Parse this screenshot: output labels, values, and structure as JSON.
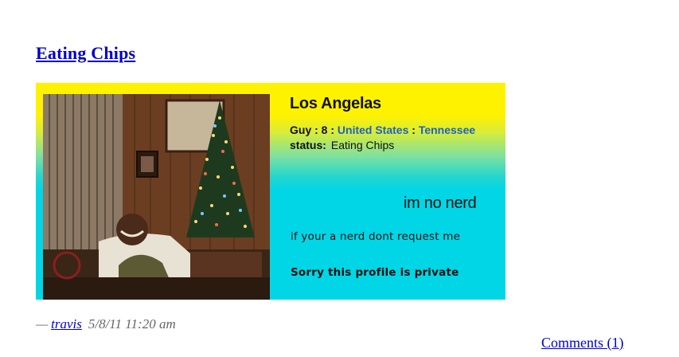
{
  "post": {
    "title": "Eating Chips",
    "meta": {
      "dash": "—",
      "author": "travis",
      "date": "5/8/11 11:20 am"
    },
    "comments_label": "Comments (1)"
  },
  "profile_card": {
    "name": "Los Angelas",
    "details_prefix": "Guy : 8 : ",
    "country": "United States",
    "separator": " : ",
    "state": "Tennessee",
    "status_label": "status:",
    "status_value": "Eating Chips",
    "headline": "im no nerd",
    "about": "if your a nerd dont request me",
    "private_notice": "Sorry this profile is private",
    "colors": {
      "top": "#fff200",
      "bottom": "#00d6e6",
      "link": "#1b63c6"
    }
  }
}
